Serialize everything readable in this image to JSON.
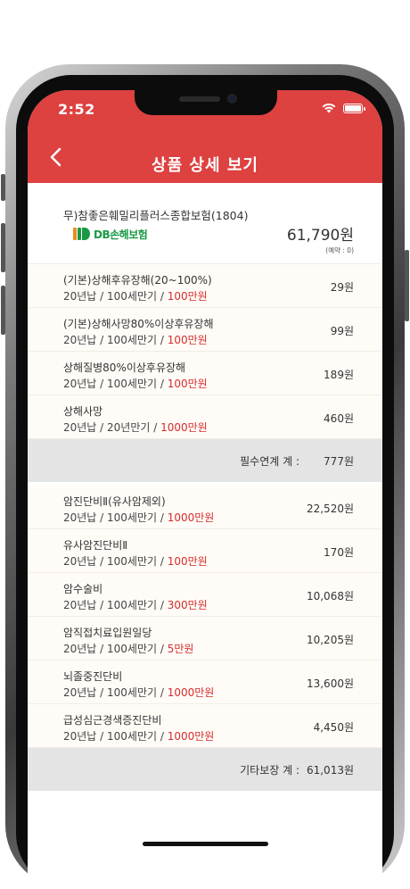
{
  "status_bar": {
    "time": "2:52"
  },
  "header": {
    "title": "상품 상세 보기"
  },
  "product": {
    "name": "무)참좋은훼밀리플러스종합보험(1804)",
    "insurer_logo_text": "DB손해보험",
    "total_price": "61,790원",
    "note": "(예약 : 0)"
  },
  "required_group": {
    "items": [
      {
        "name": "(기본)상해후유장해(20~100%)",
        "terms": "20년납 / 100세만기 / ",
        "amount": "100만원",
        "price": "29원"
      },
      {
        "name": "(기본)상해사망80%이상후유장해",
        "terms": "20년납 / 100세만기 / ",
        "amount": "100만원",
        "price": "99원"
      },
      {
        "name": "상해질병80%이상후유장해",
        "terms": "20년납 / 100세만기 / ",
        "amount": "100만원",
        "price": "189원"
      },
      {
        "name": "상해사망",
        "terms": "20년납 / 20년만기 / ",
        "amount": "1000만원",
        "price": "460원"
      }
    ],
    "subtotal_label": "필수연계 계 :",
    "subtotal_value": "777원"
  },
  "other_group": {
    "items": [
      {
        "name": "암진단비Ⅱ(유사암제외)",
        "terms": "20년납 / 100세만기 / ",
        "amount": "1000만원",
        "price": "22,520원"
      },
      {
        "name": "유사암진단비Ⅱ",
        "terms": "20년납 / 100세만기 / ",
        "amount": "100만원",
        "price": "170원"
      },
      {
        "name": "암수술비",
        "terms": "20년납 / 100세만기 / ",
        "amount": "300만원",
        "price": "10,068원"
      },
      {
        "name": "암직접치료입원일당",
        "terms": "20년납 / 100세만기 / ",
        "amount": "5만원",
        "price": "10,205원"
      },
      {
        "name": "뇌졸중진단비",
        "terms": "20년납 / 100세만기 / ",
        "amount": "1000만원",
        "price": "13,600원"
      },
      {
        "name": "급성심근경색증진단비",
        "terms": "20년납 / 100세만기 / ",
        "amount": "1000만원",
        "price": "4,450원"
      }
    ],
    "subtotal_label": "기타보장 계 :",
    "subtotal_value": "61,013원"
  },
  "colors": {
    "header": "#dd4140",
    "amount": "#d52c2c",
    "row_bg": "#fffcf7",
    "subtotal_bg": "#e4e4e4"
  },
  "icons": [
    "chevron-left-icon",
    "wifi-icon",
    "battery-icon",
    "db-logo-mark"
  ]
}
